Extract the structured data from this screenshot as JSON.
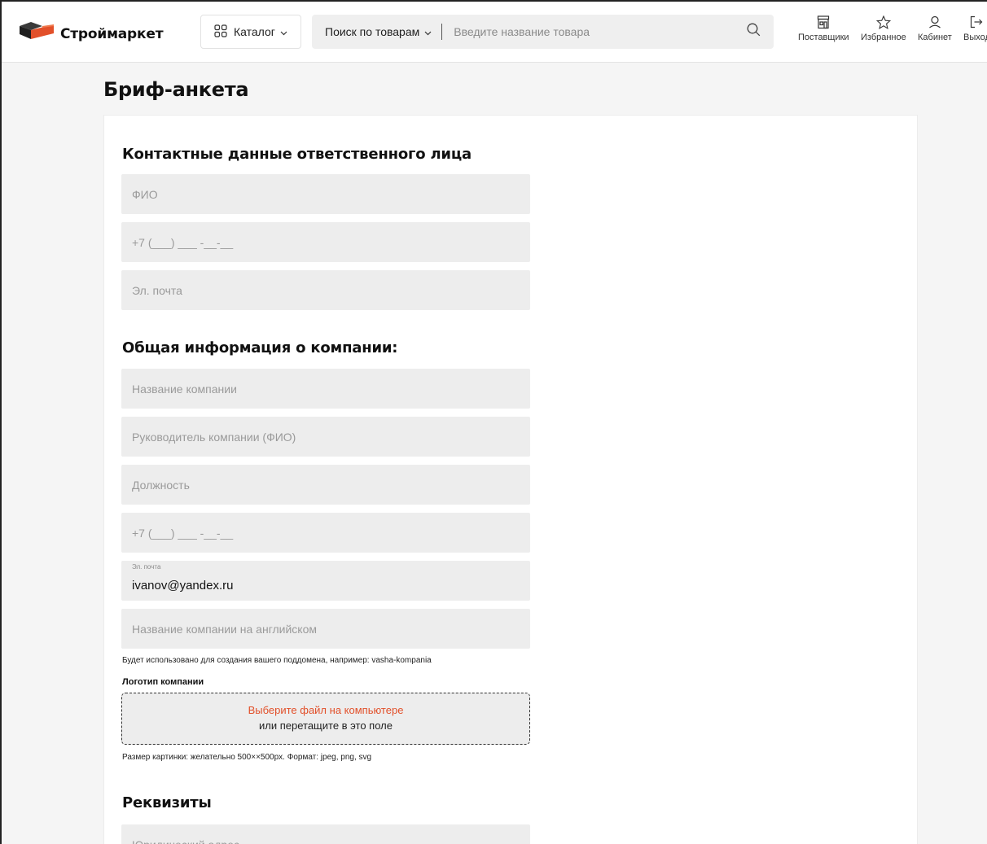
{
  "header": {
    "brand": "Строймаркет",
    "catalog_label": "Каталог",
    "search_mode": "Поиск по товарам",
    "search_placeholder": "Введите название товара",
    "nav": [
      {
        "label": "Поставщики",
        "icon": "store-icon"
      },
      {
        "label": "Избранное",
        "icon": "star-icon"
      },
      {
        "label": "Кабинет",
        "icon": "user-icon"
      },
      {
        "label": "Выход",
        "icon": "logout-icon"
      }
    ]
  },
  "page": {
    "title": "Бриф-анкета"
  },
  "contact": {
    "title": "Контактные данные ответственного лица",
    "fio_placeholder": "ФИО",
    "phone_placeholder": "+7 (___) ___ -__-__",
    "email_placeholder": "Эл. почта"
  },
  "company": {
    "title": "Общая информация о компании:",
    "name_placeholder": "Название компании",
    "director_placeholder": "Руководитель компании (ФИО)",
    "position_placeholder": "Должность",
    "phone_placeholder": "+7 (___) ___ -__-__",
    "email_label": "Эл. почта",
    "email_value": "ivanov@yandex.ru",
    "name_en_placeholder": "Название компании на английском",
    "subdomain_hint": "Будет использовано для создания вашего поддомена, например: vasha-kompania",
    "logo_label": "Логотип компании",
    "logo_choose": "Выберите файл на компьютере",
    "logo_drag": "или перетащите в это поле",
    "logo_hint": "Размер картинки: желательно 500××500px. Формат: jpeg, png, svg"
  },
  "requisites": {
    "title": "Реквизиты",
    "address_placeholder": "Юридический адрес"
  },
  "colors": {
    "accent": "#e2502a",
    "logo_dark": "#2b2b2b",
    "field_bg": "#ededed"
  }
}
